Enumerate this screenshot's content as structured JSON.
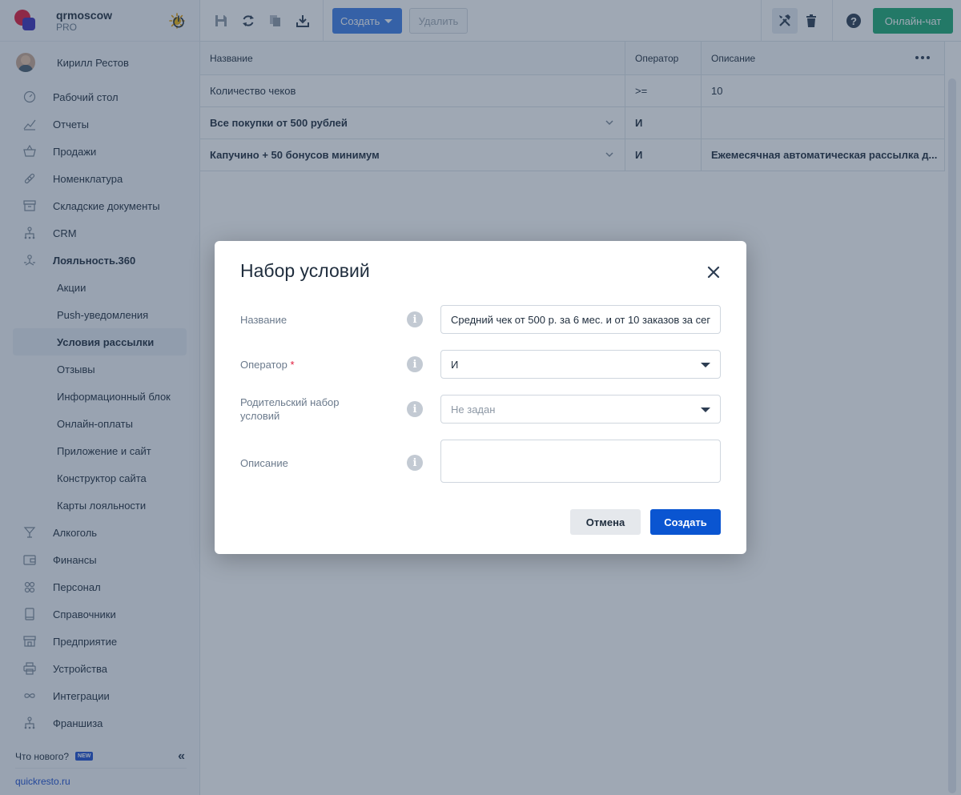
{
  "brand": {
    "name": "qrmoscow",
    "plan": "PRO"
  },
  "user": {
    "name": "Кирилл Рестов"
  },
  "sidebar": {
    "items": [
      {
        "label": "Рабочий стол",
        "icon": "dashboard-icon"
      },
      {
        "label": "Отчеты",
        "icon": "chart-icon"
      },
      {
        "label": "Продажи",
        "icon": "basket-icon"
      },
      {
        "label": "Номенклатура",
        "icon": "link-icon"
      },
      {
        "label": "Складские документы",
        "icon": "archive-icon"
      },
      {
        "label": "CRM",
        "icon": "hierarchy-icon"
      },
      {
        "label": "Лояльность.360",
        "icon": "loyalty-icon"
      },
      {
        "label": "Акции"
      },
      {
        "label": "Push-уведомления"
      },
      {
        "label": "Условия рассылки"
      },
      {
        "label": "Отзывы"
      },
      {
        "label": "Информационный блок"
      },
      {
        "label": "Онлайн-оплаты"
      },
      {
        "label": "Приложение и сайт"
      },
      {
        "label": "Конструктор сайта"
      },
      {
        "label": "Карты лояльности"
      },
      {
        "label": "Алкоголь",
        "icon": "cocktail-icon"
      },
      {
        "label": "Финансы",
        "icon": "wallet-icon"
      },
      {
        "label": "Персонал",
        "icon": "people-icon"
      },
      {
        "label": "Справочники",
        "icon": "book-icon"
      },
      {
        "label": "Предприятие",
        "icon": "store-icon"
      },
      {
        "label": "Устройства",
        "icon": "printer-icon"
      },
      {
        "label": "Интеграции",
        "icon": "infinity-icon"
      },
      {
        "label": "Франшиза",
        "icon": "hierarchy-icon"
      }
    ],
    "whats_new": "Что нового?",
    "new_badge": "NEW",
    "site": "quickresto.ru"
  },
  "toolbar": {
    "create_label": "Создать",
    "delete_label": "Удалить",
    "chat_label": "Онлайн-чат"
  },
  "table": {
    "headers": {
      "name": "Название",
      "operator": "Оператор",
      "description": "Описание"
    },
    "rows": [
      {
        "name": "Количество чеков",
        "operator": ">=",
        "description": "10"
      },
      {
        "name": "Все покупки от 500 рублей",
        "operator": "И",
        "description": ""
      },
      {
        "name": "Капучино + 50 бонусов минимум",
        "operator": "И",
        "description": "Ежемесячная автоматическая рассылка д..."
      }
    ]
  },
  "modal": {
    "title": "Набор условий",
    "fields": {
      "name_label": "Название",
      "name_value": "Средний чек от 500 р. за 6 мес. и от 10 заказов за сег",
      "operator_label": "Оператор",
      "operator_required": "*",
      "operator_value": "И",
      "parent_label_line1": "Родительский набор",
      "parent_label_line2": "условий",
      "parent_placeholder": "Не задан",
      "description_label": "Описание",
      "description_value": ""
    },
    "cancel_label": "Отмена",
    "create_label": "Создать"
  },
  "colors": {
    "accent": "#0a55d1",
    "chat": "#1eaa73",
    "brand_red": "#e0193a",
    "brand_blue": "#3b2fb8"
  }
}
